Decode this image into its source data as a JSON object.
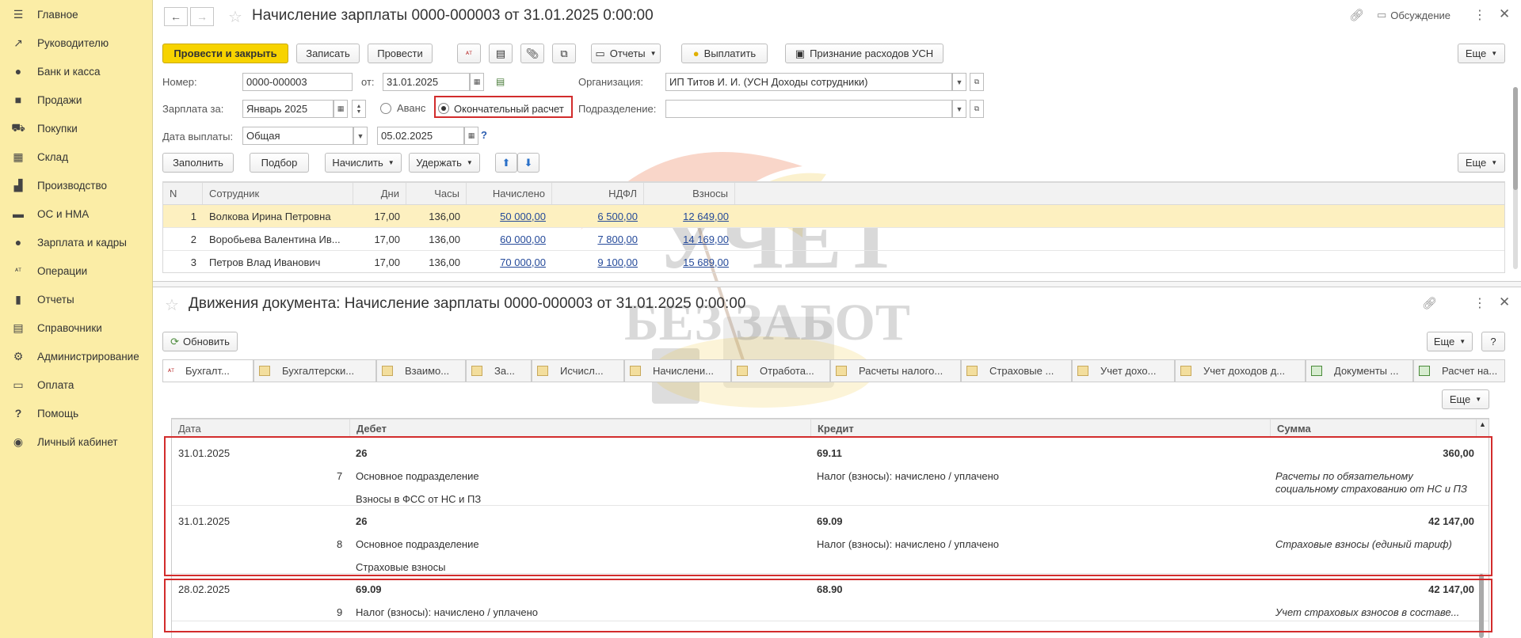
{
  "sidebar": {
    "items": [
      {
        "label": "Главное",
        "icon": "menu-icon"
      },
      {
        "label": "Руководителю",
        "icon": "trend-icon"
      },
      {
        "label": "Банк и касса",
        "icon": "coin-icon"
      },
      {
        "label": "Продажи",
        "icon": "bag-icon"
      },
      {
        "label": "Покупки",
        "icon": "cart-icon"
      },
      {
        "label": "Склад",
        "icon": "grid-icon"
      },
      {
        "label": "Производство",
        "icon": "factory-icon"
      },
      {
        "label": "ОС и НМА",
        "icon": "truck-icon"
      },
      {
        "label": "Зарплата и кадры",
        "icon": "person-icon"
      },
      {
        "label": "Операции",
        "icon": "dtkt-icon"
      },
      {
        "label": "Отчеты",
        "icon": "chart-icon"
      },
      {
        "label": "Справочники",
        "icon": "book-icon"
      },
      {
        "label": "Администрирование",
        "icon": "gear-icon"
      },
      {
        "label": "Оплата",
        "icon": "card-icon"
      },
      {
        "label": "Помощь",
        "icon": "question-icon"
      },
      {
        "label": "Личный кабинет",
        "icon": "account-icon"
      }
    ]
  },
  "doc": {
    "title": "Начисление зарплаты 0000-000003 от 31.01.2025 0:00:00",
    "discuss": "Обсуждение",
    "toolbar": {
      "post_close": "Провести и закрыть",
      "save": "Записать",
      "post": "Провести",
      "reports": "Отчеты",
      "pay": "Выплатить",
      "usn": "Признание расходов УСН",
      "more": "Еще"
    },
    "fields": {
      "number_label": "Номер:",
      "number_value": "0000-000003",
      "from_label": "от:",
      "date_value": "31.01.2025",
      "org_label": "Организация:",
      "org_value": "ИП Титов И. И. (УСН Доходы сотрудники)",
      "salary_for_label": "Зарплата за:",
      "salary_for_value": "Январь 2025",
      "advance_label": "Аванс",
      "final_label": "Окончательный расчет",
      "division_label": "Подразделение:",
      "division_value": "",
      "pay_date_label": "Дата выплаты:",
      "pay_type_value": "Общая",
      "pay_date_value": "05.02.2025",
      "help": "?"
    },
    "grid_toolbar": {
      "fill": "Заполнить",
      "pick": "Подбор",
      "accrue": "Начислить",
      "withhold": "Удержать",
      "more": "Еще"
    },
    "grid": {
      "columns": [
        "N",
        "Сотрудник",
        "Дни",
        "Часы",
        "Начислено",
        "НДФЛ",
        "Взносы"
      ],
      "rows": [
        {
          "n": "1",
          "employee": "Волкова Ирина Петровна",
          "days": "17,00",
          "hours": "136,00",
          "accrued": "50 000,00",
          "ndfl": "6 500,00",
          "contrib": "12 649,00"
        },
        {
          "n": "2",
          "employee": "Воробьева Валентина Ив...",
          "days": "17,00",
          "hours": "136,00",
          "accrued": "60 000,00",
          "ndfl": "7 800,00",
          "contrib": "14 169,00"
        },
        {
          "n": "3",
          "employee": "Петров Влад Иванович",
          "days": "17,00",
          "hours": "136,00",
          "accrued": "70 000,00",
          "ndfl": "9 100,00",
          "contrib": "15 689,00"
        }
      ]
    }
  },
  "movements": {
    "title": "Движения документа: Начисление зарплаты 0000-000003 от 31.01.2025 0:00:00",
    "refresh": "Обновить",
    "more": "Еще",
    "help": "?",
    "inner_more": "Еще",
    "tabs": [
      "Бухгалт...",
      "Бухгалтерски...",
      "Взаимо...",
      "За...",
      "Исчисл...",
      "Начислени...",
      "Отработа...",
      "Расчеты налого...",
      "Страховые ...",
      "Учет дохо...",
      "Учет доходов д...",
      "Документы ...",
      "Расчет на..."
    ],
    "columns": [
      "Дата",
      "Дебет",
      "Кредит",
      "Сумма"
    ],
    "entries": [
      {
        "date": "31.01.2025",
        "n": "7",
        "debit": "26",
        "debit_sub1": "Основное подразделение",
        "debit_sub2": "Взносы в ФСС от НС и ПЗ",
        "credit": "69.11",
        "credit_sub1": "Налог (взносы): начислено / уплачено",
        "sum": "360,00",
        "note": "Расчеты по обязательному социальному страхованию от НС и ПЗ"
      },
      {
        "date": "31.01.2025",
        "n": "8",
        "debit": "26",
        "debit_sub1": "Основное подразделение",
        "debit_sub2": "Страховые взносы",
        "credit": "69.09",
        "credit_sub1": "Налог (взносы): начислено / уплачено",
        "sum": "42 147,00",
        "note": "Страховые взносы (единый тариф)"
      },
      {
        "date": "28.02.2025",
        "n": "9",
        "debit": "69.09",
        "debit_sub1": "Налог (взносы): начислено / уплачено",
        "debit_sub2": "",
        "credit": "68.90",
        "credit_sub1": "",
        "sum": "42 147,00",
        "note": "Учет страховых взносов в составе..."
      }
    ]
  },
  "watermark": {
    "line1": "УЧЕТ",
    "line2": "БЕЗ ЗАБОТ"
  },
  "colors": {
    "sidebar": "#fbeda6",
    "primary_button": "#f7d300",
    "selected_row": "#fdf0c0",
    "highlight": "#d22c2c",
    "link": "#254a9a"
  }
}
